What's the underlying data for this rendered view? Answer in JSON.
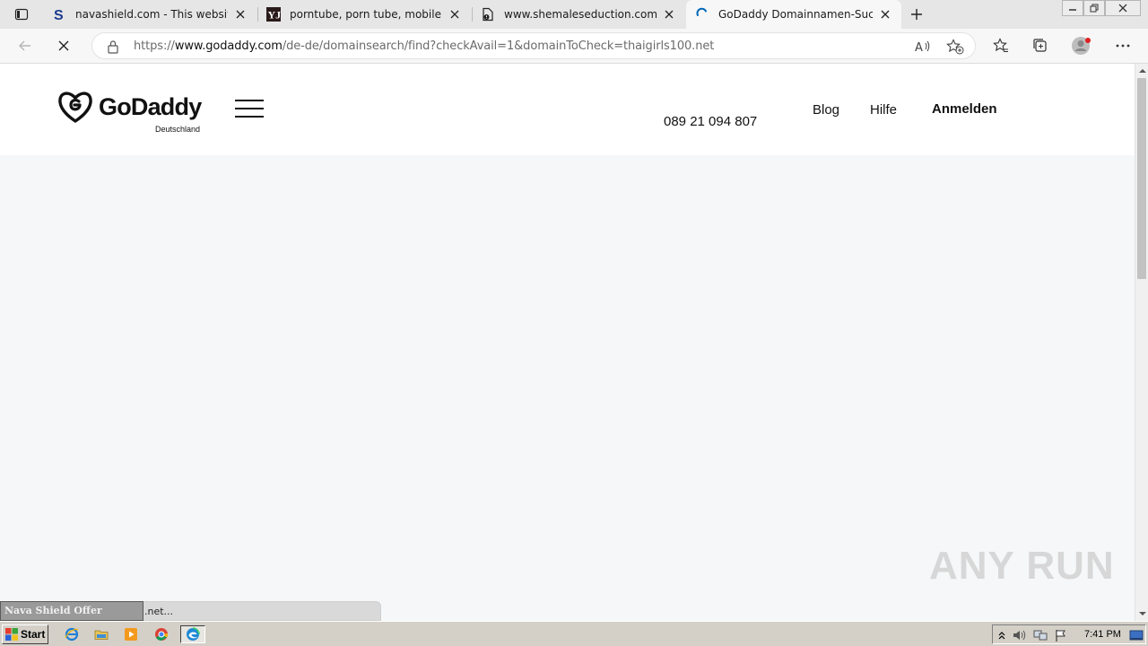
{
  "tabs": [
    {
      "title": "navashield.com - This website is for sale",
      "favicon": "navashield-s-icon",
      "active": false
    },
    {
      "title": "porntube, porn tube, mobile porn",
      "favicon": "yj-icon",
      "active": false
    },
    {
      "title": "www.shemaleseduction.com",
      "favicon": "page-error-icon",
      "active": false
    },
    {
      "title": "GoDaddy Domainnamen-Suche",
      "favicon": "loading-spinner-icon",
      "active": true
    }
  ],
  "address": {
    "url_prefix": "https://",
    "url_host": "www.godaddy.com",
    "url_path": "/de-de/domainsearch/find?checkAvail=1&domainToCheck=thaigirls100.net"
  },
  "site": {
    "logo_text": "GoDaddy",
    "country": "Deutschland",
    "phone": "089 21 094 807",
    "nav": {
      "blog": "Blog",
      "help": "Hilfe",
      "signin": "Anmelden"
    }
  },
  "status": {
    "tooltip": "Nava Shield Offer",
    "text": ".net..."
  },
  "watermark": "ANY RUN",
  "taskbar": {
    "start_label": "Start",
    "clock": "7:41 PM"
  },
  "colors": {
    "page_bg": "#f5f7f8",
    "header_bg": "#ffffff",
    "spinner": "#0067b8"
  }
}
